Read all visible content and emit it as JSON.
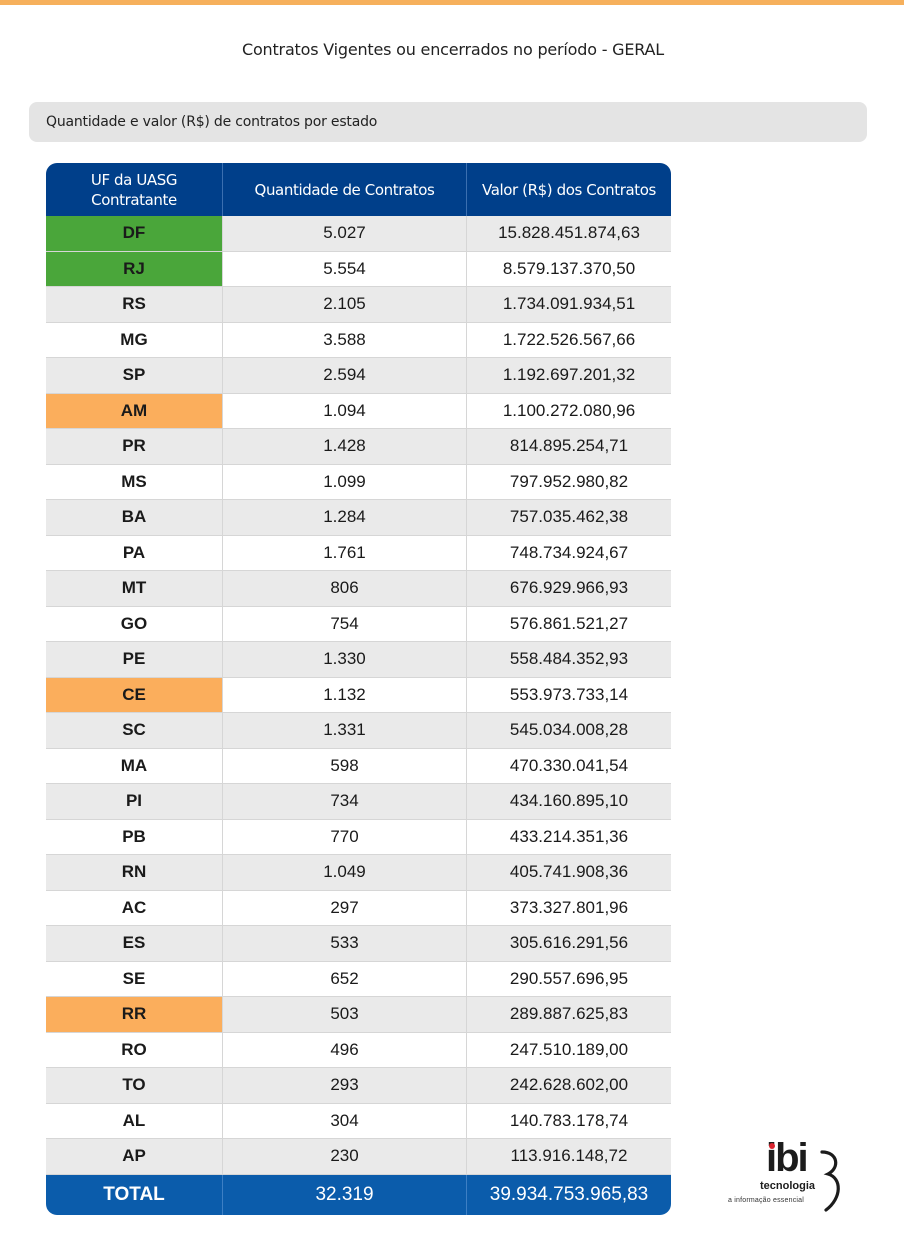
{
  "page": {
    "title": "Contratos Vigentes ou encerrados no período - GERAL",
    "section_label": "Quantidade e valor (R$) de contratos por estado"
  },
  "colors": {
    "accent_rule": "#f6b05c",
    "header_bg": "#003f8a",
    "total_bg": "#0b5cab",
    "highlight_green": "#4aa63a",
    "highlight_orange": "#fbae5c"
  },
  "table": {
    "headers": [
      "UF da UASG Contratante",
      "Quantidade de Contratos",
      "Valor (R$) dos Contratos"
    ],
    "rows": [
      {
        "uf": "DF",
        "qtd": "5.027",
        "valor": "15.828.451.874,63",
        "highlight": "green"
      },
      {
        "uf": "RJ",
        "qtd": "5.554",
        "valor": "8.579.137.370,50",
        "highlight": "green"
      },
      {
        "uf": "RS",
        "qtd": "2.105",
        "valor": "1.734.091.934,51",
        "highlight": ""
      },
      {
        "uf": "MG",
        "qtd": "3.588",
        "valor": "1.722.526.567,66",
        "highlight": ""
      },
      {
        "uf": "SP",
        "qtd": "2.594",
        "valor": "1.192.697.201,32",
        "highlight": ""
      },
      {
        "uf": "AM",
        "qtd": "1.094",
        "valor": "1.100.272.080,96",
        "highlight": "orange"
      },
      {
        "uf": "PR",
        "qtd": "1.428",
        "valor": "814.895.254,71",
        "highlight": ""
      },
      {
        "uf": "MS",
        "qtd": "1.099",
        "valor": "797.952.980,82",
        "highlight": ""
      },
      {
        "uf": "BA",
        "qtd": "1.284",
        "valor": "757.035.462,38",
        "highlight": ""
      },
      {
        "uf": "PA",
        "qtd": "1.761",
        "valor": "748.734.924,67",
        "highlight": ""
      },
      {
        "uf": "MT",
        "qtd": "806",
        "valor": "676.929.966,93",
        "highlight": ""
      },
      {
        "uf": "GO",
        "qtd": "754",
        "valor": "576.861.521,27",
        "highlight": ""
      },
      {
        "uf": "PE",
        "qtd": "1.330",
        "valor": "558.484.352,93",
        "highlight": ""
      },
      {
        "uf": "CE",
        "qtd": "1.132",
        "valor": "553.973.733,14",
        "highlight": "orange"
      },
      {
        "uf": "SC",
        "qtd": "1.331",
        "valor": "545.034.008,28",
        "highlight": ""
      },
      {
        "uf": "MA",
        "qtd": "598",
        "valor": "470.330.041,54",
        "highlight": ""
      },
      {
        "uf": "PI",
        "qtd": "734",
        "valor": "434.160.895,10",
        "highlight": ""
      },
      {
        "uf": "PB",
        "qtd": "770",
        "valor": "433.214.351,36",
        "highlight": ""
      },
      {
        "uf": "RN",
        "qtd": "1.049",
        "valor": "405.741.908,36",
        "highlight": ""
      },
      {
        "uf": "AC",
        "qtd": "297",
        "valor": "373.327.801,96",
        "highlight": ""
      },
      {
        "uf": "ES",
        "qtd": "533",
        "valor": "305.616.291,56",
        "highlight": ""
      },
      {
        "uf": "SE",
        "qtd": "652",
        "valor": "290.557.696,95",
        "highlight": ""
      },
      {
        "uf": "RR",
        "qtd": "503",
        "valor": "289.887.625,83",
        "highlight": "orange"
      },
      {
        "uf": "RO",
        "qtd": "496",
        "valor": "247.510.189,00",
        "highlight": ""
      },
      {
        "uf": "TO",
        "qtd": "293",
        "valor": "242.628.602,00",
        "highlight": ""
      },
      {
        "uf": "AL",
        "qtd": "304",
        "valor": "140.783.178,74",
        "highlight": ""
      },
      {
        "uf": "AP",
        "qtd": "230",
        "valor": "113.916.148,72",
        "highlight": ""
      }
    ],
    "total": {
      "label": "TOTAL",
      "qtd": "32.319",
      "valor": "39.934.753.965,83"
    }
  },
  "logo": {
    "word": "ibi",
    "tagline": "tecnologia",
    "subtagline": "a informação essencial"
  }
}
